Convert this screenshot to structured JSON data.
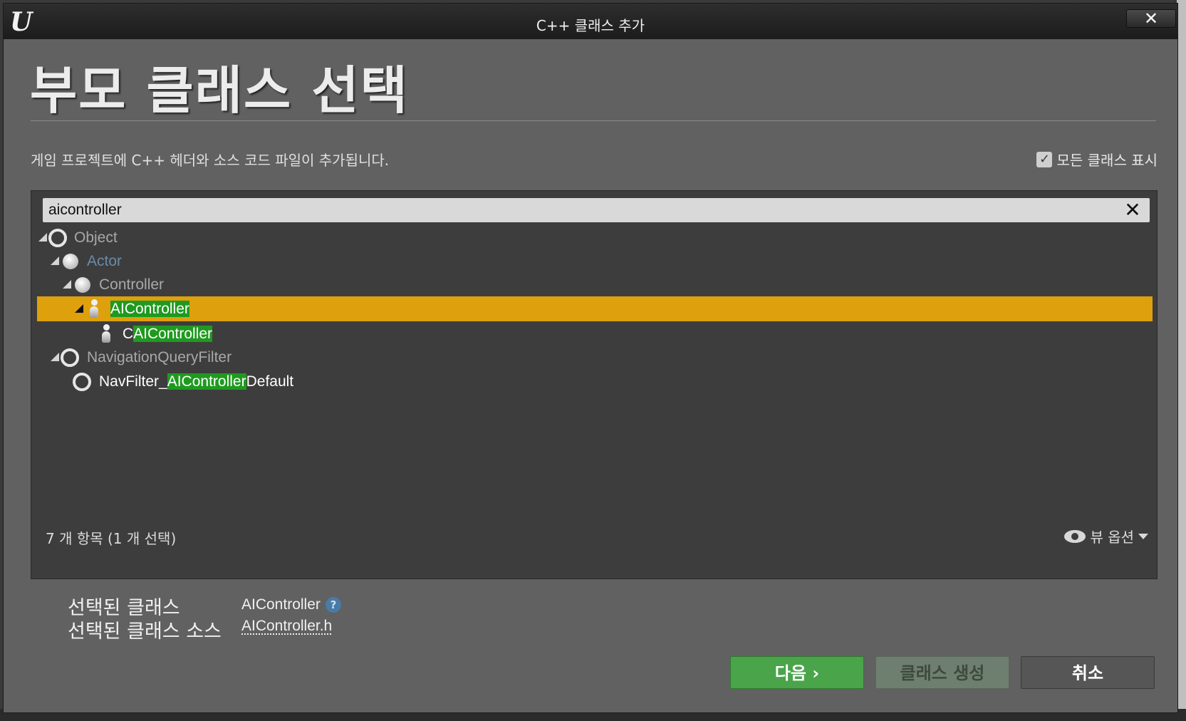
{
  "window": {
    "title": "C++ 클래스 추가",
    "close_label": "✕",
    "logo": "U"
  },
  "header": {
    "title": "부모 클래스 선택",
    "subtitle": "게임 프로젝트에 C++ 헤더와 소스 코드 파일이 추가됩니다.",
    "show_all_label": "모든 클래스 표시",
    "show_all_checked": "✓"
  },
  "search": {
    "value": "aicontroller",
    "placeholder": "",
    "clear_label": "✕"
  },
  "tree": {
    "rows": [
      {
        "name": "Object",
        "parts": [
          "Object"
        ],
        "icon": "ring-icon"
      },
      {
        "name": "Actor",
        "parts": [
          "Actor"
        ],
        "icon": "ball-icon"
      },
      {
        "name": "Controller",
        "parts": [
          "Controller"
        ],
        "icon": "ball-icon"
      },
      {
        "name": "AIController",
        "parts": [
          "AIController"
        ],
        "icon": "pawn-icon",
        "selected": true
      },
      {
        "name": "CAIController",
        "parts": [
          "C",
          "AIController"
        ],
        "icon": "pawn-icon"
      },
      {
        "name": "NavigationQueryFilter",
        "parts": [
          "NavigationQueryFilter"
        ],
        "icon": "ring-icon"
      },
      {
        "name": "NavFilter_AIControllerDefault",
        "parts": [
          "NavFilter_",
          "AIController",
          "Default"
        ],
        "icon": "ring-icon"
      }
    ],
    "item_count": "7 개 항목 (1 개 선택)",
    "view_options_label": "뷰 옵션"
  },
  "selection": {
    "class_label": "선택된 클래스",
    "class_value": "AIController",
    "source_label": "선택된 클래스 소스",
    "source_value": "AIController.h",
    "help_label": "?"
  },
  "buttons": {
    "next": "다음 ›",
    "generate": "클래스 생성",
    "cancel": "취소"
  }
}
